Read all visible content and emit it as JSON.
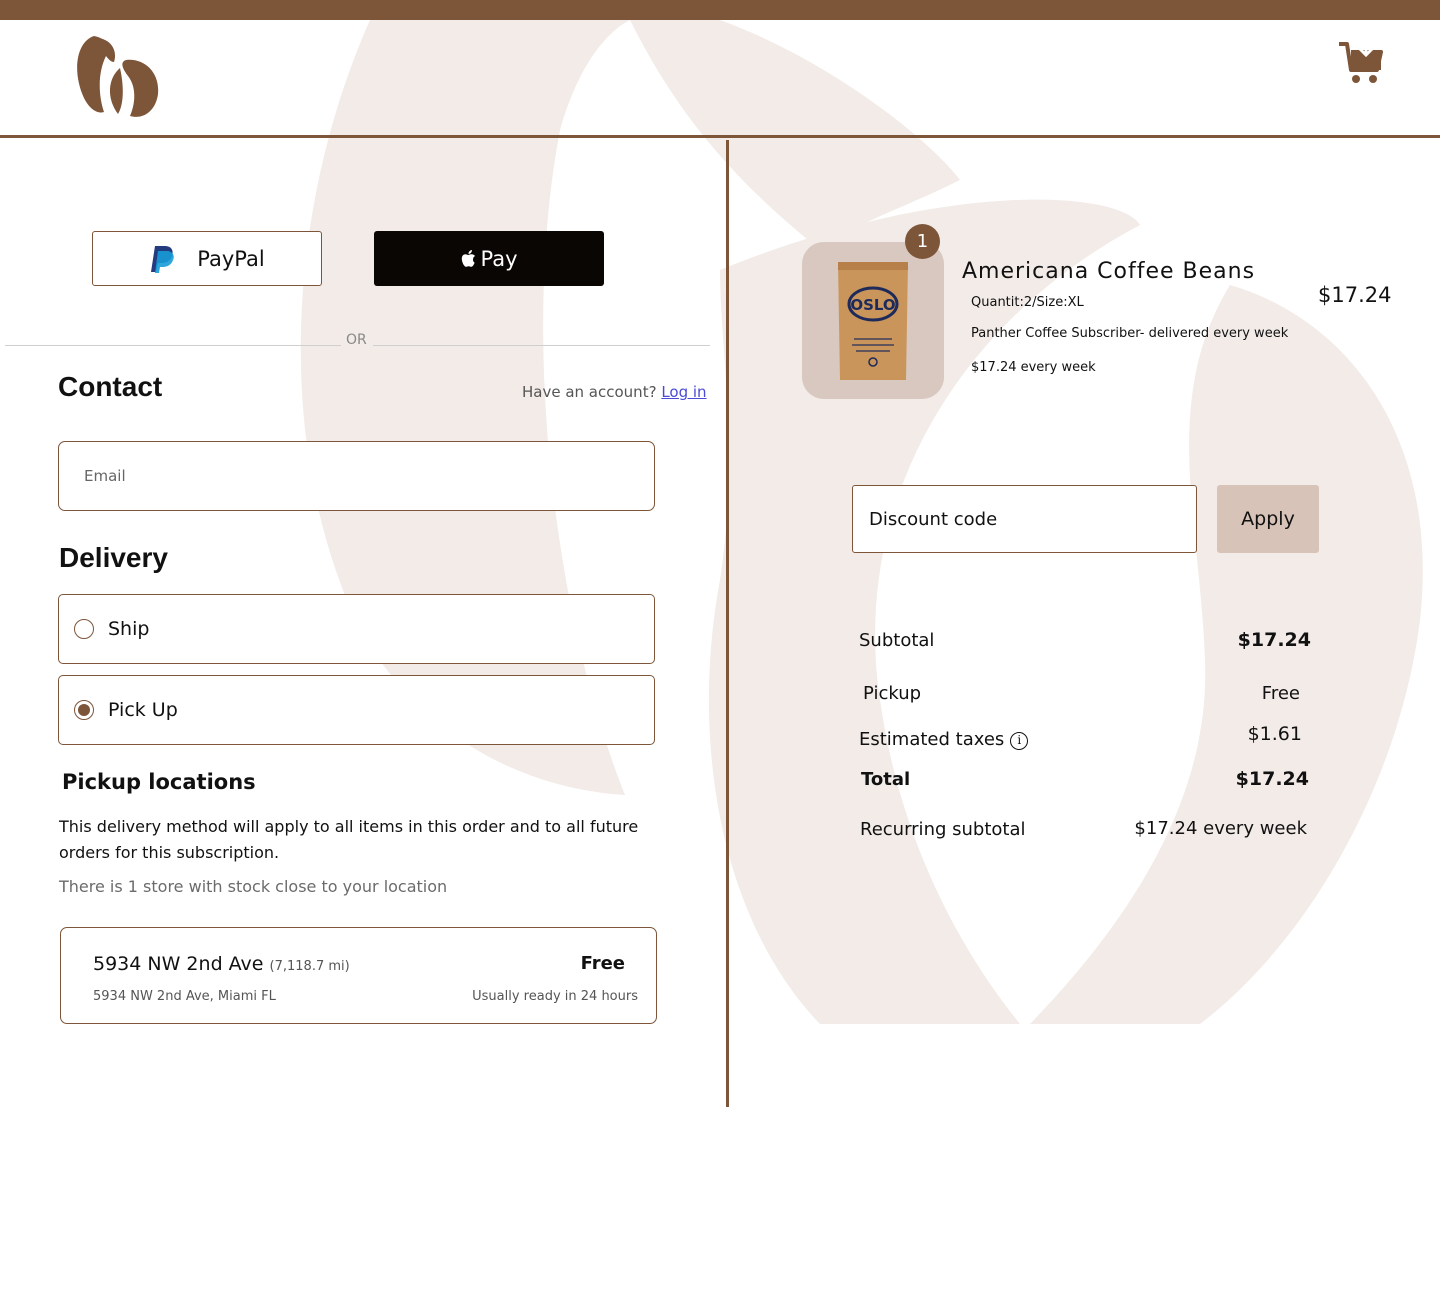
{
  "header": {
    "logo_icon": "coffee-beans-logo-icon",
    "cart_icon": "cart-download-icon"
  },
  "colors": {
    "brand_brown": "#7d5539",
    "background_beans": "#f2ebe8",
    "apply_button": "#d8c3b8",
    "link_blue": "#4a4ad6"
  },
  "express_checkout": {
    "paypal_label": "PayPal",
    "applepay_label": "Pay",
    "or_label": "OR"
  },
  "contact": {
    "title": "Contact",
    "account_prompt": "Have an account?",
    "login_label": "Log in",
    "email_placeholder": "Email"
  },
  "delivery": {
    "title": "Delivery",
    "options": [
      {
        "label": "Ship",
        "selected": false
      },
      {
        "label": "Pick Up",
        "selected": true
      }
    ]
  },
  "pickup": {
    "title": "Pickup locations",
    "note": "This delivery method will apply to all items in this order and to all future orders for this subscription.",
    "stock_note": "There is 1 store with stock close to your location",
    "location": {
      "name": "5934 NW 2nd Ave",
      "distance": "(7,118.7 mi)",
      "address": "5934 NW 2nd Ave, Miami FL",
      "price": "Free",
      "ready": "Usually ready in 24 hours"
    }
  },
  "cart_item": {
    "quantity": "1",
    "name": "Americana Coffee Beans",
    "meta": "Quantit:2/Size:XL",
    "subscription": "Panther Coffee Subscriber- delivered every week",
    "recurring": "$17.24 every week",
    "price": "$17.24",
    "bag_brand": "OSLO"
  },
  "discount": {
    "placeholder": "Discount code",
    "apply_label": "Apply"
  },
  "summary": {
    "subtotal_label": "Subtotal",
    "subtotal_value": "$17.24",
    "pickup_label": "Pickup",
    "pickup_value": "Free",
    "taxes_label": "Estimated taxes",
    "taxes_value": "$1.61",
    "total_label": "Total",
    "total_value": "$17.24",
    "recurring_label": "Recurring subtotal",
    "recurring_value": "$17.24 every week"
  }
}
